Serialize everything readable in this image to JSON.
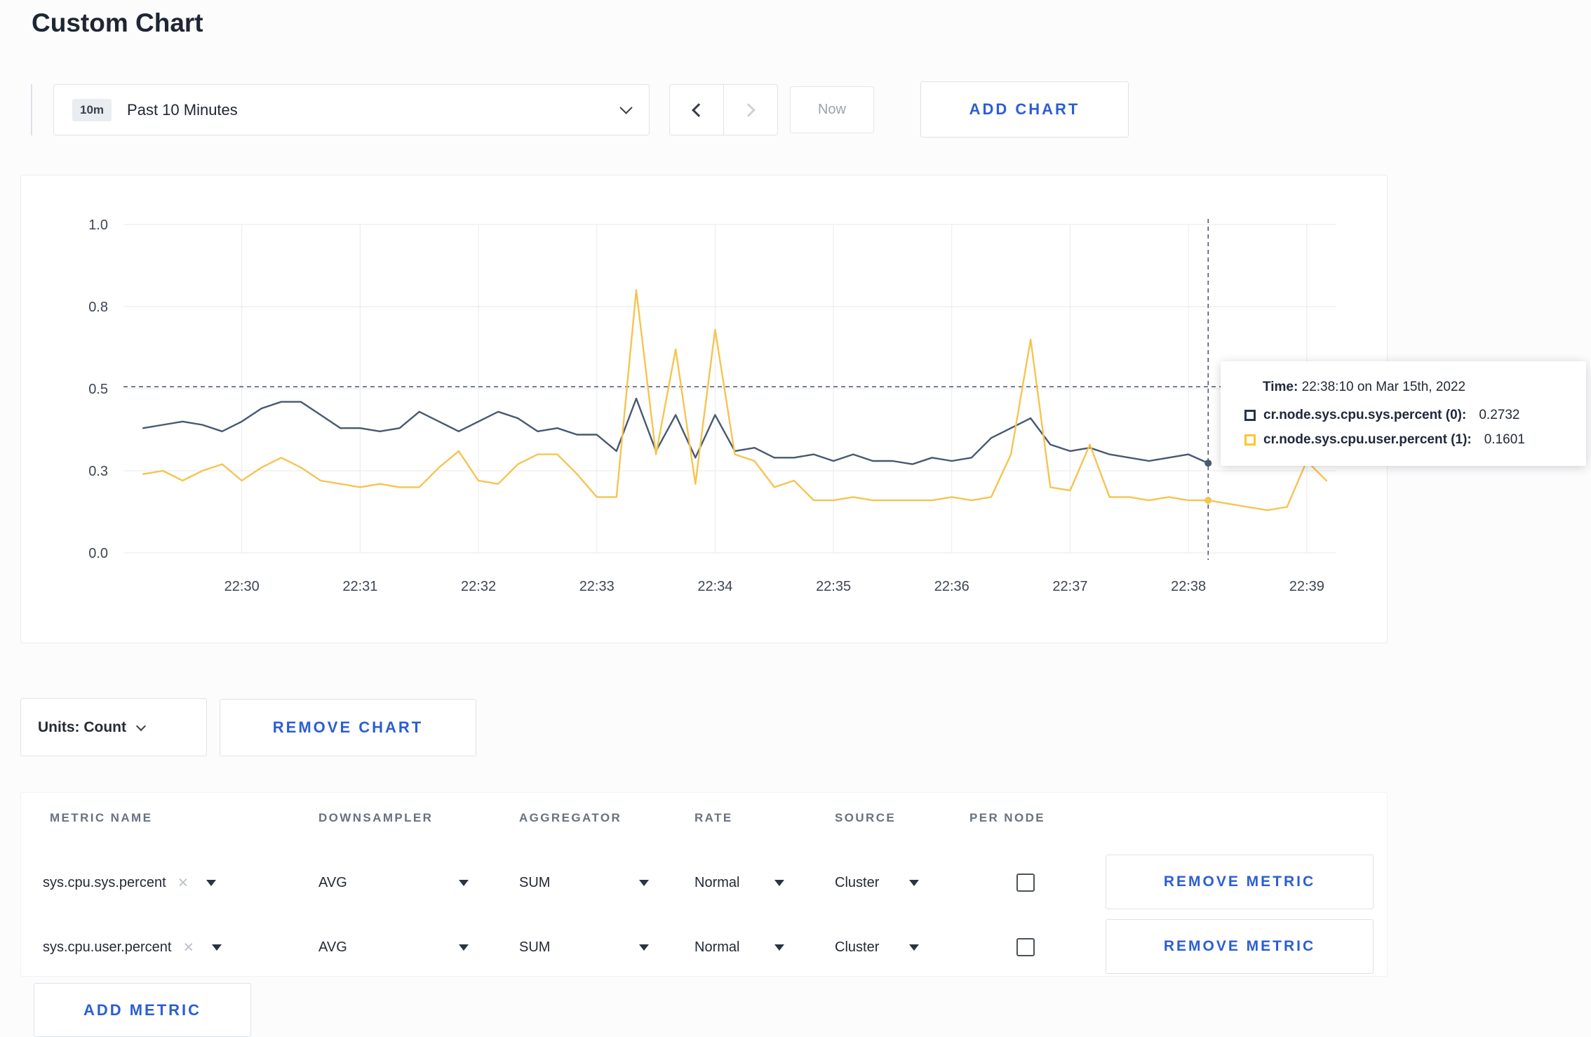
{
  "page": {
    "title": "Custom Chart"
  },
  "toolbar": {
    "time_range": {
      "badge": "10m",
      "label": "Past 10 Minutes"
    },
    "now_label": "Now",
    "add_chart_label": "ADD CHART"
  },
  "chart_controls": {
    "units_label": "Units: Count",
    "remove_chart_label": "REMOVE CHART"
  },
  "chart_tooltip": {
    "time_label": "Time:",
    "time_value": "22:38:10 on Mar 15th, 2022",
    "rows": [
      {
        "swatch_color": "#25344f",
        "label": "cr.node.sys.cpu.sys.percent (0):",
        "value": "0.2732"
      },
      {
        "swatch_color": "#fdc530",
        "label": "cr.node.sys.cpu.user.percent (1):",
        "value": "0.1601"
      }
    ]
  },
  "chart_data": {
    "type": "line",
    "title": "",
    "xlabel": "",
    "ylabel": "",
    "ylim": [
      0,
      1
    ],
    "grid": true,
    "x_domain": [
      "22:29:00",
      "22:39:15"
    ],
    "x_ticks": [
      "22:30",
      "22:31",
      "22:32",
      "22:33",
      "22:34",
      "22:35",
      "22:36",
      "22:37",
      "22:38",
      "22:39"
    ],
    "y_ticks": [
      {
        "value": 0,
        "label": "0.0"
      },
      {
        "value": 0.25,
        "label": "0.3"
      },
      {
        "value": 0.5,
        "label": "0.5"
      },
      {
        "value": 0.75,
        "label": "0.8"
      },
      {
        "value": 1,
        "label": "1.0"
      }
    ],
    "crosshair": {
      "time": "22:38:10",
      "hline_value": 0.506
    },
    "series": [
      {
        "name": "cr.node.sys.cpu.sys.percent (0)",
        "color": "#475872",
        "points": [
          [
            "22:29:10",
            0.38
          ],
          [
            "22:29:20",
            0.39
          ],
          [
            "22:29:30",
            0.4
          ],
          [
            "22:29:40",
            0.39
          ],
          [
            "22:29:50",
            0.37
          ],
          [
            "22:30:00",
            0.4
          ],
          [
            "22:30:10",
            0.44
          ],
          [
            "22:30:20",
            0.46
          ],
          [
            "22:30:30",
            0.46
          ],
          [
            "22:30:40",
            0.42
          ],
          [
            "22:30:50",
            0.38
          ],
          [
            "22:31:00",
            0.38
          ],
          [
            "22:31:10",
            0.37
          ],
          [
            "22:31:20",
            0.38
          ],
          [
            "22:31:30",
            0.43
          ],
          [
            "22:31:40",
            0.4
          ],
          [
            "22:31:50",
            0.37
          ],
          [
            "22:32:00",
            0.4
          ],
          [
            "22:32:10",
            0.43
          ],
          [
            "22:32:20",
            0.41
          ],
          [
            "22:32:30",
            0.37
          ],
          [
            "22:32:40",
            0.38
          ],
          [
            "22:32:50",
            0.36
          ],
          [
            "22:33:00",
            0.36
          ],
          [
            "22:33:10",
            0.31
          ],
          [
            "22:33:20",
            0.47
          ],
          [
            "22:33:30",
            0.31
          ],
          [
            "22:33:40",
            0.42
          ],
          [
            "22:33:50",
            0.29
          ],
          [
            "22:34:00",
            0.42
          ],
          [
            "22:34:10",
            0.31
          ],
          [
            "22:34:20",
            0.32
          ],
          [
            "22:34:30",
            0.29
          ],
          [
            "22:34:40",
            0.29
          ],
          [
            "22:34:50",
            0.3
          ],
          [
            "22:35:00",
            0.28
          ],
          [
            "22:35:10",
            0.3
          ],
          [
            "22:35:20",
            0.28
          ],
          [
            "22:35:30",
            0.28
          ],
          [
            "22:35:40",
            0.27
          ],
          [
            "22:35:50",
            0.29
          ],
          [
            "22:36:00",
            0.28
          ],
          [
            "22:36:10",
            0.29
          ],
          [
            "22:36:20",
            0.35
          ],
          [
            "22:36:30",
            0.38
          ],
          [
            "22:36:40",
            0.41
          ],
          [
            "22:36:50",
            0.33
          ],
          [
            "22:37:00",
            0.31
          ],
          [
            "22:37:10",
            0.32
          ],
          [
            "22:37:20",
            0.3
          ],
          [
            "22:37:30",
            0.29
          ],
          [
            "22:37:40",
            0.28
          ],
          [
            "22:37:50",
            0.29
          ],
          [
            "22:38:00",
            0.3
          ],
          [
            "22:38:10",
            0.2732
          ]
        ]
      },
      {
        "name": "cr.node.sys.cpu.user.percent (1)",
        "color": "#f5c451",
        "points": [
          [
            "22:29:10",
            0.24
          ],
          [
            "22:29:20",
            0.25
          ],
          [
            "22:29:30",
            0.22
          ],
          [
            "22:29:40",
            0.25
          ],
          [
            "22:29:50",
            0.27
          ],
          [
            "22:30:00",
            0.22
          ],
          [
            "22:30:10",
            0.26
          ],
          [
            "22:30:20",
            0.29
          ],
          [
            "22:30:30",
            0.26
          ],
          [
            "22:30:40",
            0.22
          ],
          [
            "22:30:50",
            0.21
          ],
          [
            "22:31:00",
            0.2
          ],
          [
            "22:31:10",
            0.21
          ],
          [
            "22:31:20",
            0.2
          ],
          [
            "22:31:30",
            0.2
          ],
          [
            "22:31:40",
            0.26
          ],
          [
            "22:31:50",
            0.31
          ],
          [
            "22:32:00",
            0.22
          ],
          [
            "22:32:10",
            0.21
          ],
          [
            "22:32:20",
            0.27
          ],
          [
            "22:32:30",
            0.3
          ],
          [
            "22:32:40",
            0.3
          ],
          [
            "22:32:50",
            0.24
          ],
          [
            "22:33:00",
            0.17
          ],
          [
            "22:33:10",
            0.17
          ],
          [
            "22:33:20",
            0.8
          ],
          [
            "22:33:30",
            0.3
          ],
          [
            "22:33:40",
            0.62
          ],
          [
            "22:33:50",
            0.21
          ],
          [
            "22:34:00",
            0.68
          ],
          [
            "22:34:10",
            0.3
          ],
          [
            "22:34:20",
            0.28
          ],
          [
            "22:34:30",
            0.2
          ],
          [
            "22:34:40",
            0.22
          ],
          [
            "22:34:50",
            0.16
          ],
          [
            "22:35:00",
            0.16
          ],
          [
            "22:35:10",
            0.17
          ],
          [
            "22:35:20",
            0.16
          ],
          [
            "22:35:30",
            0.16
          ],
          [
            "22:35:40",
            0.16
          ],
          [
            "22:35:50",
            0.16
          ],
          [
            "22:36:00",
            0.17
          ],
          [
            "22:36:10",
            0.16
          ],
          [
            "22:36:20",
            0.17
          ],
          [
            "22:36:30",
            0.3
          ],
          [
            "22:36:40",
            0.65
          ],
          [
            "22:36:50",
            0.2
          ],
          [
            "22:37:00",
            0.19
          ],
          [
            "22:37:10",
            0.33
          ],
          [
            "22:37:20",
            0.17
          ],
          [
            "22:37:30",
            0.17
          ],
          [
            "22:37:40",
            0.16
          ],
          [
            "22:37:50",
            0.17
          ],
          [
            "22:38:00",
            0.16
          ],
          [
            "22:38:10",
            0.1601
          ],
          [
            "22:38:20",
            0.15
          ],
          [
            "22:38:30",
            0.14
          ],
          [
            "22:38:40",
            0.13
          ],
          [
            "22:38:50",
            0.14
          ],
          [
            "22:39:00",
            0.28
          ],
          [
            "22:39:10",
            0.22
          ]
        ]
      }
    ]
  },
  "metrics_table": {
    "headers": [
      "METRIC NAME",
      "DOWNSAMPLER",
      "AGGREGATOR",
      "RATE",
      "SOURCE",
      "PER NODE"
    ],
    "rows": [
      {
        "metric": "sys.cpu.sys.percent",
        "downsampler": "AVG",
        "aggregator": "SUM",
        "rate": "Normal",
        "source": "Cluster",
        "remove_label": "REMOVE METRIC"
      },
      {
        "metric": "sys.cpu.user.percent",
        "downsampler": "AVG",
        "aggregator": "SUM",
        "rate": "Normal",
        "source": "Cluster",
        "remove_label": "REMOVE METRIC"
      }
    ],
    "add_metric_label": "ADD METRIC"
  }
}
